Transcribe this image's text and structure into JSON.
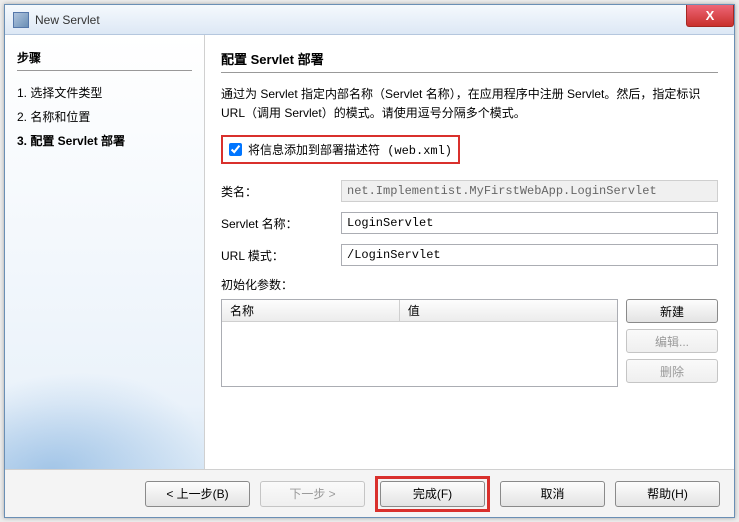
{
  "window": {
    "title": "New Servlet",
    "close": "X"
  },
  "sidebar": {
    "steps_title": "步骤",
    "items": [
      {
        "label": "1. 选择文件类型",
        "current": false
      },
      {
        "label": "2. 名称和位置",
        "current": false
      },
      {
        "label": "3. 配置 Servlet 部署",
        "current": true
      }
    ]
  },
  "main": {
    "title": "配置 Servlet 部署",
    "description": "通过为 Servlet 指定内部名称（Servlet 名称），在应用程序中注册 Servlet。然后，指定标识 URL（调用 Servlet）的模式。请使用逗号分隔多个模式。",
    "checkbox": {
      "label": "将信息添加到部署描述符 (web.xml)",
      "checked": true
    },
    "fields": {
      "className": {
        "label": "类名：",
        "value": "net.Implementist.MyFirstWebApp.LoginServlet"
      },
      "servletName": {
        "label": "Servlet 名称：",
        "value": "LoginServlet"
      },
      "urlPattern": {
        "label": "URL 模式：",
        "value": "/LoginServlet"
      }
    },
    "params": {
      "title": "初始化参数：",
      "col_name": "名称",
      "col_value": "值"
    },
    "side_buttons": {
      "new": "新建",
      "edit": "编辑...",
      "delete": "删除"
    }
  },
  "footer": {
    "back": "< 上一步(B)",
    "next": "下一步 >",
    "finish": "完成(F)",
    "cancel": "取消",
    "help": "帮助(H)"
  }
}
